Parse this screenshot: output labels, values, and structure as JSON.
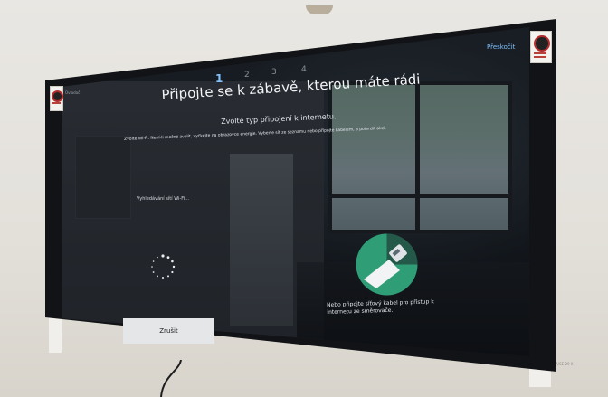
{
  "header": {
    "skip_label": "Přeskočit",
    "left_tiny": "Ovladač",
    "steps": [
      "1",
      "2",
      "3",
      "4"
    ],
    "active_step": "1"
  },
  "main": {
    "title": "Připojte se k zábavě, kterou máte rádi",
    "subtitle": "Zvolte typ připojení k internetu.",
    "hint": "Zvolte Wi-Fi. Není-li možné zvolit, vyčkejte na obrazovce energie. Vyberte síť ze seznamu nebo připojte kabelem, a potvrdit akci.",
    "wifi_search_label": "Vyhledávání sítí Wi-Fi...",
    "cable_text": "Nebo připojte síťový kabel pro přístup k internetu ze směrovače.",
    "cancel_label": "Zrušit"
  },
  "icons": {
    "loading": "loading-spinner-icon",
    "ethernet": "ethernet-cable-icon"
  },
  "colors": {
    "accent_blue": "#7fc2ff",
    "ethernet_green": "#2f9e76",
    "button_bg": "#e4e6e8"
  },
  "corner": {
    "text": "A/SE 29-X"
  }
}
